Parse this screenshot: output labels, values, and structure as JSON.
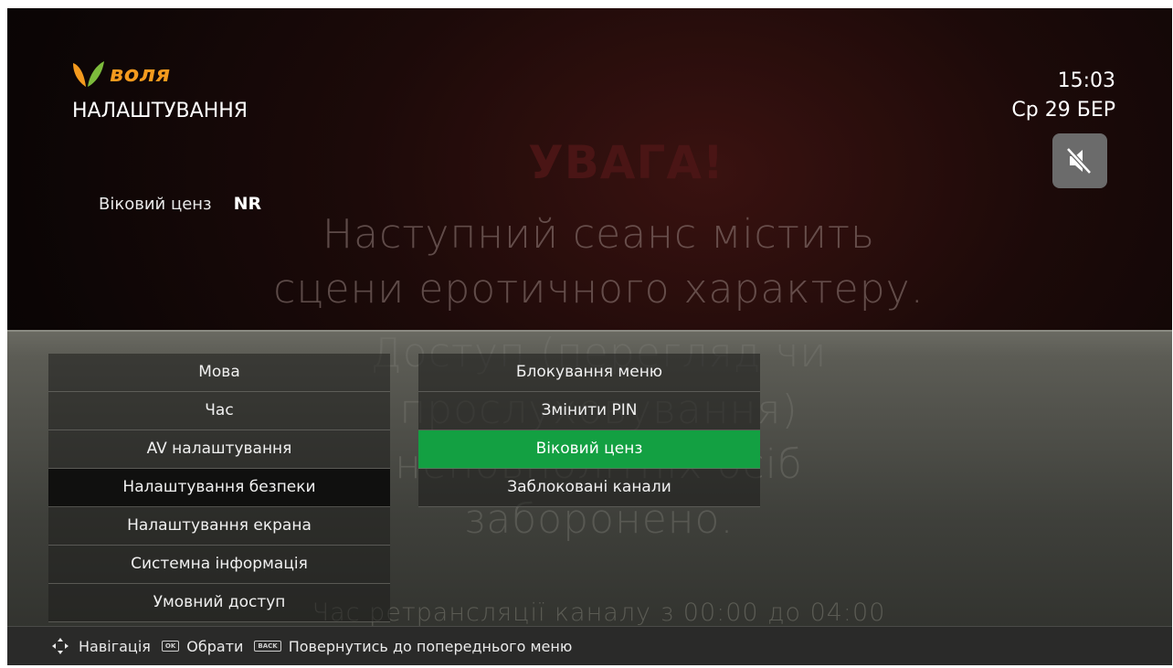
{
  "header": {
    "brand": "воля",
    "title": "НАЛАШТУВАННЯ",
    "time": "15:03",
    "date": "Ср 29 БЕР",
    "mute_icon": "speaker-muted-icon"
  },
  "setting": {
    "label": "Віковий ценз",
    "value": "NR"
  },
  "background_text": {
    "warning": "УВАГА!",
    "line1": "Наступний сеанс містить",
    "line2": "сцени еротичного характеру.",
    "line3": "Доступ (перегляд чи",
    "line4": "прослуховування)",
    "line5": "неповнолітніх осіб",
    "line6": "заборонено.",
    "broadcast": "Час ретрансляції каналу з 00:00 до 04:00"
  },
  "menu_left": {
    "items": [
      {
        "label": "Мова"
      },
      {
        "label": "Час"
      },
      {
        "label": "AV налаштування"
      },
      {
        "label": "Налаштування безпеки"
      },
      {
        "label": "Налаштування екрана"
      },
      {
        "label": "Системна інформація"
      },
      {
        "label": "Умовний доступ"
      }
    ],
    "active_index": 3
  },
  "menu_right": {
    "items": [
      {
        "label": "Блокування меню"
      },
      {
        "label": "Змінити PIN"
      },
      {
        "label": "Віковий ценз"
      },
      {
        "label": "Заблоковані канали"
      }
    ],
    "selected_index": 2
  },
  "footer": {
    "nav_label": "Навігація",
    "ok_key": "OK",
    "ok_label": "Обрати",
    "back_key": "BACK",
    "back_label": "Повернутись до попереднього меню"
  },
  "colors": {
    "accent_green": "#13a042",
    "brand_orange": "#f39a1e"
  }
}
